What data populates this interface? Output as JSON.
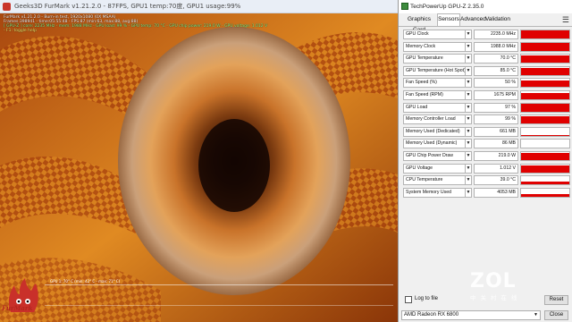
{
  "furmark": {
    "title": "Geeks3D FurMark v1.21.2.0 - 87FPS, GPU1 temp:70度, GPU1 usage:99%",
    "overlay": [
      "FurMark v1.21.2.0 - Burn-in test, 1920x1080 (0X MSAA)",
      "Frames:398941 - time:05:55:48 - FPS:87 (min:63, max:88, avg:88)",
      "[ GPU-Z ] core: 2235 MHz - mem: 1988 MHz - GPU load: 99 % - GPU temp: 70 °C - GPU chip power: 219.0 W - GPU voltage: 1.012 V",
      "- F1: toggle help"
    ],
    "graph_label": "GPU 1: 70° C (min: 42° C - max: 71° C)",
    "logo_text": "FurMark"
  },
  "gpuz": {
    "title": "TechPowerUp GPU-Z 2.35.0",
    "tabs": [
      "Graphics Card",
      "Sensors",
      "Advanced",
      "Validation"
    ],
    "active_tab": "Sensors",
    "sensors": [
      {
        "label": "GPU Clock",
        "value": "2235.0 MHz",
        "level": 0.95
      },
      {
        "label": "Memory Clock",
        "value": "1988.0 MHz",
        "level": 0.95
      },
      {
        "label": "GPU Temperature",
        "value": "70.0 °C",
        "level": 0.9
      },
      {
        "label": "GPU Temperature (Hot Spot)",
        "value": "85.0 °C",
        "level": 0.9
      },
      {
        "label": "Fan Speed (%)",
        "value": "50 %",
        "level": 0.8
      },
      {
        "label": "Fan Speed (RPM)",
        "value": "1675 RPM",
        "level": 0.8
      },
      {
        "label": "GPU Load",
        "value": "97 %",
        "level": 0.95
      },
      {
        "label": "Memory Controller Load",
        "value": "99 %",
        "level": 0.95
      },
      {
        "label": "Memory Used (Dedicated)",
        "value": "661 MB",
        "level": 0.08
      },
      {
        "label": "Memory Used (Dynamic)",
        "value": "86 MB",
        "level": 0.03
      },
      {
        "label": "GPU Chip Power Draw",
        "value": "219.0 W",
        "level": 0.9
      },
      {
        "label": "GPU Voltage",
        "value": "1.012 V",
        "level": 0.85
      },
      {
        "label": "CPU Temperature",
        "value": "39.0 °C",
        "level": 0.4
      },
      {
        "label": "System Memory Used",
        "value": "4053 MB",
        "level": 0.3
      }
    ],
    "log_to_file_label": "Log to file",
    "reset_label": "Reset",
    "close_label": "Close",
    "gpu_selected": "AMD Radeon RX 6800"
  },
  "watermark": {
    "brand": "ZOL",
    "sub": "中关村在线"
  },
  "colors": {
    "sensor_fill": "#e00000",
    "fur_orange": "#d9842a",
    "fur_center": "#2a1206"
  }
}
